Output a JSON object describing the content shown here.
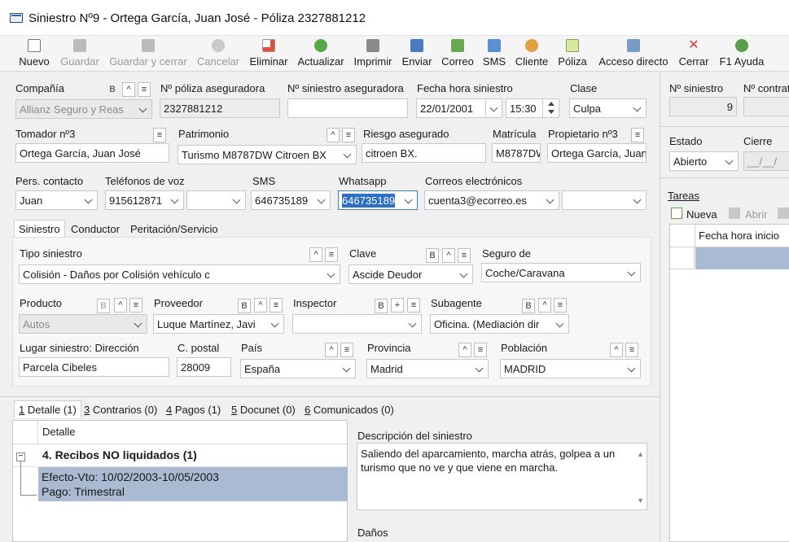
{
  "window": {
    "title": "Siniestro Nº9 - Ortega García, Juan José - Póliza 2327881212"
  },
  "toolbar": {
    "nuevo": "Nuevo",
    "guardar": "Guardar",
    "guardar_cerrar": "Guardar y cerrar",
    "cancelar": "Cancelar",
    "eliminar": "Eliminar",
    "actualizar": "Actualizar",
    "imprimir": "Imprimir",
    "enviar": "Enviar",
    "correo": "Correo",
    "sms": "SMS",
    "cliente": "Cliente",
    "poliza": "Póliza",
    "acceso_directo": "Acceso directo",
    "cerrar": "Cerrar",
    "ayuda": "F1 Ayuda"
  },
  "form": {
    "compania_label": "Compañía",
    "compania_value": "Allianz Seguro y Reas",
    "poliza_label": "Nº póliza aseguradora",
    "poliza_value": "2327881212",
    "nsin_aseg_label": "Nº siniestro aseguradora",
    "nsin_aseg_value": "",
    "fecha_label": "Fecha hora siniestro",
    "fecha_value": "22/01/2001",
    "hora_value": "15:30",
    "clase_label": "Clase",
    "clase_value": "Culpa",
    "tomador_label": "Tomador nº3",
    "tomador_value": "Ortega García, Juan José",
    "patrimonio_label": "Patrimonio",
    "patrimonio_value": "Turismo M8787DW Citroen BX",
    "riesgo_label": "Riesgo asegurado",
    "riesgo_value": "citroen BX.",
    "matricula_label": "Matrícula",
    "matricula_value": "M8787DW",
    "propietario_label": "Propietario nº3",
    "propietario_value": "Ortega García, Juan",
    "contacto_label": "Pers. contacto",
    "contacto_value": "Juan",
    "telefonos_label": "Teléfonos de voz",
    "telefono_value": "915612871",
    "telefono2_value": "",
    "sms_label": "SMS",
    "sms_value": "646735189",
    "whatsapp_label": "Whatsapp",
    "whatsapp_value": "646735189",
    "correos_label": "Correos electrónicos",
    "correo_value": "cuenta3@ecorreo.es",
    "correo2_value": ""
  },
  "tabs": {
    "siniestro": "Siniestro",
    "conductor": "Conductor",
    "peritacion": "Peritación/Servicio"
  },
  "siniestro_tab": {
    "tipo_label": "Tipo siniestro",
    "tipo_value": "Colisión - Daños por Colisión vehículo c",
    "clave_label": "Clave",
    "clave_value": "Ascide Deudor",
    "seguro_label": "Seguro de",
    "seguro_value": "Coche/Caravana",
    "producto_label": "Producto",
    "producto_value": "Autos",
    "proveedor_label": "Proveedor",
    "proveedor_value": "Luque Martínez, Javi",
    "inspector_label": "Inspector",
    "inspector_value": "",
    "subagente_label": "Subagente",
    "subagente_value": "Oficina. (Mediación dir",
    "lugar_label": "Lugar siniestro: Dirección",
    "lugar_value": "Parcela Cibeles",
    "cpostal_label": "C. postal",
    "cpostal_value": "28009",
    "pais_label": "País",
    "pais_value": "España",
    "provincia_label": "Provincia",
    "provincia_value": "Madrid",
    "poblacion_label": "Población",
    "poblacion_value": "MADRID"
  },
  "btns": {
    "b": "B",
    "up": "^",
    "menu": "≡",
    "plus": "+"
  },
  "bottom_tabs": [
    {
      "key": "1",
      "label": " Detalle (1)"
    },
    {
      "key": "3",
      "label": " Contrarios (0)"
    },
    {
      "key": "4",
      "label": " Pagos (1)"
    },
    {
      "key": "5",
      "label": " Docunet (0)"
    },
    {
      "key": "6",
      "label": " Comunicados (0)"
    }
  ],
  "detalle": {
    "header": "Detalle",
    "group": "4. Recibos NO liquidados (1)",
    "row_line1": "Efecto-Vto: 10/02/2003-10/05/2003",
    "row_line2": "Pago: Trimestral"
  },
  "descripcion": {
    "label": "Descripción del siniestro",
    "text": "Saliendo del aparcamiento, marcha atrás, golpea a un turismo que no ve y que viene en marcha."
  },
  "danos_label": "Daños",
  "right": {
    "nsiniestro_label": "Nº siniestro",
    "nsiniestro_value": "9",
    "ncontrato_label": "Nº contrat",
    "estado_label": "Estado",
    "estado_value": "Abierto",
    "cierre_label": "Cierre",
    "cierre_value": "__/__/",
    "tareas_label": "Tareas",
    "nueva_label": "Nueva",
    "abrir_label": "Abrir",
    "fecha_inicio_header": "Fecha hora inicio"
  }
}
